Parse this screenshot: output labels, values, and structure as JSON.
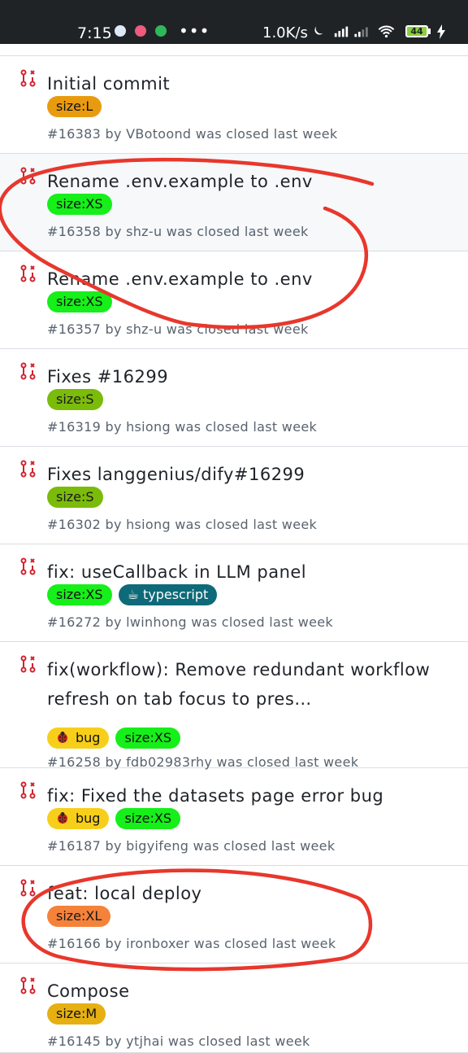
{
  "status_bar": {
    "time": "7:15",
    "more": "•••",
    "net_speed": "1.0K/s",
    "battery": "44"
  },
  "colors": {
    "size_L": "#e99b0f",
    "size_XS": "#16ef19",
    "size_S": "#7bbb0a",
    "size_XL": "#f5823a",
    "size_M": "#e6b012",
    "bug": "#f7cf1b",
    "typescript": "#0e6a78",
    "closed_icon": "#d1242f",
    "annotation": "#e8372c"
  },
  "pull_requests": [
    {
      "title": "Initial commit",
      "labels": [
        {
          "text": "size:L",
          "kind": "size_L"
        }
      ],
      "meta": "#16383 by VBotoond was closed last week"
    },
    {
      "title": "Rename .env.example to .env",
      "labels": [
        {
          "text": "size:XS",
          "kind": "size_XS"
        }
      ],
      "meta": "#16358 by shz-u was closed last week"
    },
    {
      "title": "Rename .env.example to .env",
      "labels": [
        {
          "text": "size:XS",
          "kind": "size_XS"
        }
      ],
      "meta": "#16357 by shz-u was closed last week"
    },
    {
      "title": "Fixes #16299",
      "labels": [
        {
          "text": "size:S",
          "kind": "size_S"
        }
      ],
      "meta": "#16319 by hsiong was closed last week"
    },
    {
      "title": "Fixes langgenius/dify#16299",
      "labels": [
        {
          "text": "size:S",
          "kind": "size_S"
        }
      ],
      "meta": "#16302 by hsiong was closed last week"
    },
    {
      "title": "fix: useCallback in LLM panel",
      "labels": [
        {
          "text": "size:XS",
          "kind": "size_XS"
        },
        {
          "text": "☕ typescript",
          "kind": "typescript"
        }
      ],
      "meta": "#16272 by lwinhong was closed last week"
    },
    {
      "title": "fix(workflow): Remove redundant workflow refresh on tab focus to pres…",
      "labels": [
        {
          "text": "bug",
          "kind": "bug"
        },
        {
          "text": "size:XS",
          "kind": "size_XS"
        }
      ],
      "meta": "#16258 by fdb02983rhy was closed last week"
    },
    {
      "title": "fix: Fixed the datasets page error bug",
      "labels": [
        {
          "text": "bug",
          "kind": "bug"
        },
        {
          "text": "size:XS",
          "kind": "size_XS"
        }
      ],
      "meta": "#16187 by bigyifeng was closed last week"
    },
    {
      "title": "feat: local deploy",
      "labels": [
        {
          "text": "size:XL",
          "kind": "size_XL"
        }
      ],
      "meta": "#16166 by ironboxer was closed last week"
    },
    {
      "title": "Compose",
      "labels": [
        {
          "text": "size:M",
          "kind": "size_M"
        }
      ],
      "meta": "#16145 by ytjhai was closed last week"
    }
  ]
}
